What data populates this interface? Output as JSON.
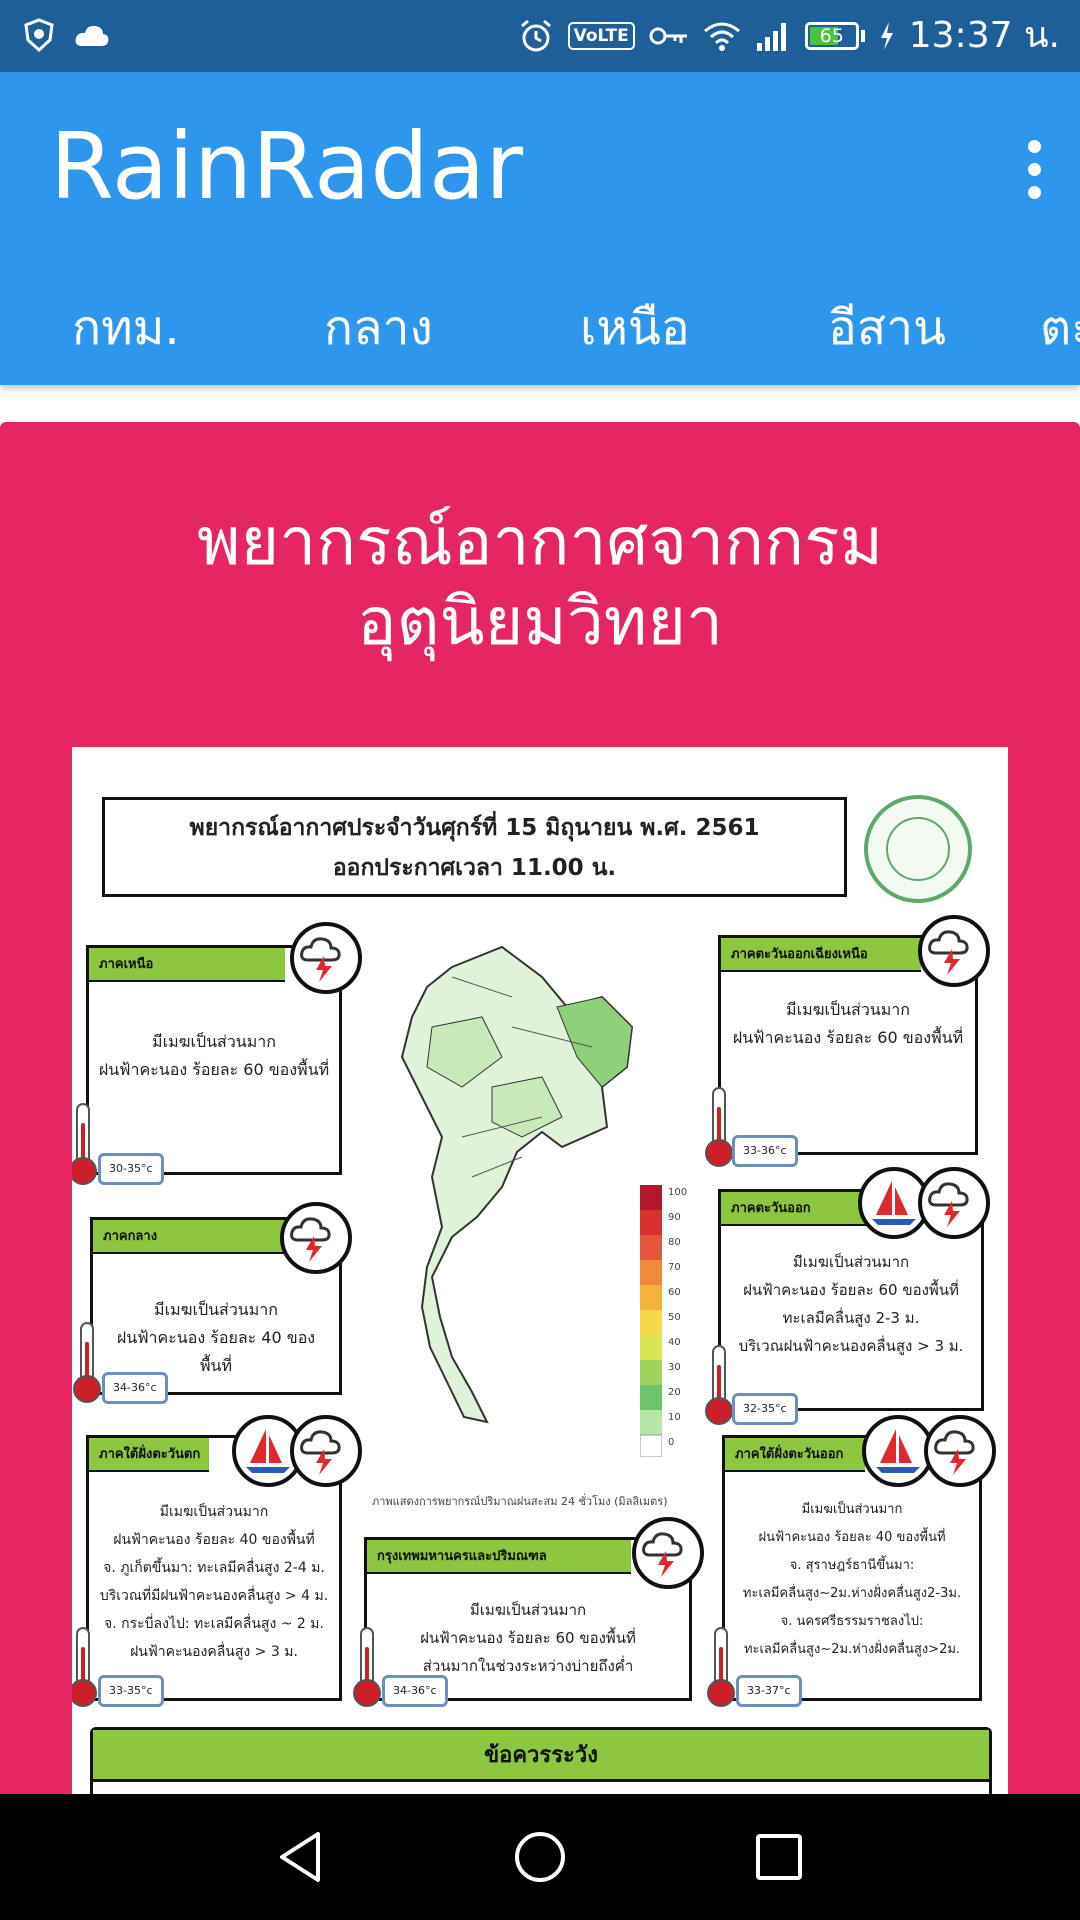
{
  "status_bar": {
    "time": "13:37 น.",
    "battery_level": "65",
    "battery_fraction": 0.65,
    "network_label": "VoLTE",
    "icons": [
      "shield-icon",
      "cloud-icon",
      "alarm-icon",
      "volte-icon",
      "key-icon",
      "wifi-icon",
      "signal-icon",
      "battery-icon",
      "charging-icon"
    ]
  },
  "app_bar": {
    "title": "RainRadar",
    "menu_icon": "more-vert-icon",
    "tabs": [
      {
        "label": "กทม."
      },
      {
        "label": "กลาง"
      },
      {
        "label": "เหนือ"
      },
      {
        "label": "อีสาน"
      },
      {
        "label": "ตะ"
      }
    ]
  },
  "card": {
    "title": "พยากรณ์อากาศจากกรมอุตุนิยมวิทยา",
    "poster": {
      "header_line1": "พยากรณ์อากาศประจำวันศุกร์ที่ 15 มิถุนายน พ.ศ. 2561",
      "header_line2": "ออกประกาศเวลา 11.00 น.",
      "regions": [
        {
          "name": "ภาคเหนือ",
          "lines": [
            "มีเมฆเป็นส่วนมาก",
            "ฝนฟ้าคะนอง ร้อยละ 60 ของพื้นที่"
          ],
          "temp": "30-35°c"
        },
        {
          "name": "ภาคกลาง",
          "lines": [
            "มีเมฆเป็นส่วนมาก",
            "ฝนฟ้าคะนอง ร้อยละ 40 ของพื้นที่"
          ],
          "temp": "34-36°c"
        },
        {
          "name": "ภาคใต้ฝั่งตะวันตก",
          "lines": [
            "มีเมฆเป็นส่วนมาก",
            "ฝนฟ้าคะนอง ร้อยละ 40 ของพื้นที่",
            "จ. ภูเก็ตขึ้นมา: ทะเลมีคลื่นสูง 2-4 ม.",
            "บริเวณที่มีฝนฟ้าคะนองคลื่นสูง > 4 ม.",
            "จ. กระบี่ลงไป: ทะเลมีคลื่นสูง ~ 2 ม.",
            "ฝนฟ้าคะนองคลื่นสูง > 3 ม."
          ],
          "temp": "33-35°c"
        },
        {
          "name": "กรุงเทพมหานครและปริมณฑล",
          "lines": [
            "มีเมฆเป็นส่วนมาก",
            "ฝนฟ้าคะนอง ร้อยละ 60 ของพื้นที่",
            "ส่วนมากในช่วงระหว่างบ่ายถึงค่ำ"
          ],
          "temp": "34-36°c"
        },
        {
          "name": "ภาคตะวันออกเฉียงเหนือ",
          "lines": [
            "มีเมฆเป็นส่วนมาก",
            "ฝนฟ้าคะนอง ร้อยละ 60 ของพื้นที่"
          ],
          "temp": "33-36°c"
        },
        {
          "name": "ภาคตะวันออก",
          "lines": [
            "มีเมฆเป็นส่วนมาก",
            "ฝนฟ้าคะนอง ร้อยละ 60 ของพื้นที่",
            "ทะเลมีคลื่นสูง 2-3 ม.",
            "บริเวณฝนฟ้าคะนองคลื่นสูง > 3 ม."
          ],
          "temp": "32-35°c"
        },
        {
          "name": "ภาคใต้ฝั่งตะวันออก",
          "lines": [
            "มีเมฆเป็นส่วนมาก",
            "ฝนฟ้าคะนอง ร้อยละ 40 ของพื้นที่",
            "จ. สุราษฎร์ธานีขึ้นมา:",
            "ทะเลมีคลื่นสูง~2ม.ห่างฝั่งคลื่นสูง2-3ม.",
            "จ. นครศรีธรรมราชลงไป:",
            "ทะเลมีคลื่นสูง~2ม.ห่างฝั่งคลื่นสูง>2ม."
          ],
          "temp": "33-37°c"
        }
      ],
      "map_caption": "ภาพแสดงการพยากรณ์ปริมาณฝนสะสม 24 ชั่วโมง (มิลลิเมตร)",
      "scale_labels": [
        "100",
        "90",
        "80",
        "70",
        "60",
        "50",
        "40",
        "30",
        "20",
        "10",
        "0"
      ],
      "caution_title": "ข้อควรระวัง"
    }
  },
  "nav_bar": {
    "buttons": [
      "back-icon",
      "home-icon",
      "recents-icon"
    ]
  }
}
